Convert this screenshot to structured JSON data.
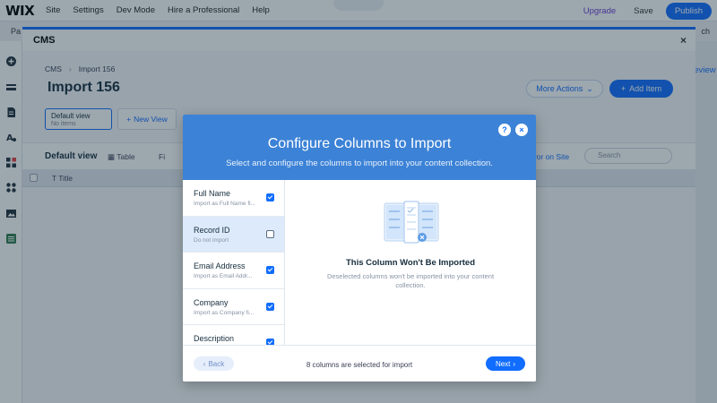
{
  "editor": {
    "logo": "WIX",
    "nav": [
      "Site",
      "Settings",
      "Dev Mode",
      "Hire a Professional",
      "Help"
    ],
    "upgrade": "Upgrade",
    "save": "Save",
    "preview": "Preview",
    "publish": "Publish",
    "secbar_left": "Pa",
    "secbar_right": "ch"
  },
  "cms": {
    "panel_title": "CMS",
    "close": "×",
    "breadcrumb": [
      "CMS",
      "Import 156"
    ],
    "page_title": "Import 156",
    "more_actions": "More Actions",
    "add_item": "Add Item",
    "view_card": {
      "title": "Default view",
      "subtitle": "No items"
    },
    "new_view": "New View",
    "toolbar": {
      "view_name": "Default view",
      "layout": "Table",
      "filter_partial": "Fi",
      "error_link": "rror on Site",
      "search_placeholder": "Search"
    },
    "table_header": {
      "first_column": "Title"
    }
  },
  "modal": {
    "title": "Configure Columns to Import",
    "subtitle": "Select and configure the columns to import into your content collection.",
    "help": "?",
    "close": "×",
    "columns": [
      {
        "name": "Full Name",
        "desc": "Import as Full Name fi...",
        "checked": true
      },
      {
        "name": "Record ID",
        "desc": "Do not import",
        "checked": false
      },
      {
        "name": "Email Address",
        "desc": "Import as Email Addr...",
        "checked": true
      },
      {
        "name": "Company",
        "desc": "Import as Company fi...",
        "checked": true
      },
      {
        "name": "Description",
        "desc": "",
        "checked": true
      }
    ],
    "preview_title": "This Column Won't Be Imported",
    "preview_desc": "Deselected columns won't be imported into your content collection.",
    "back": "Back",
    "footer_text": "8 columns are selected for import",
    "next": "Next",
    "colors": {
      "header": "#3c82d6",
      "accent": "#116dff",
      "selected_row": "#dceafb"
    }
  }
}
